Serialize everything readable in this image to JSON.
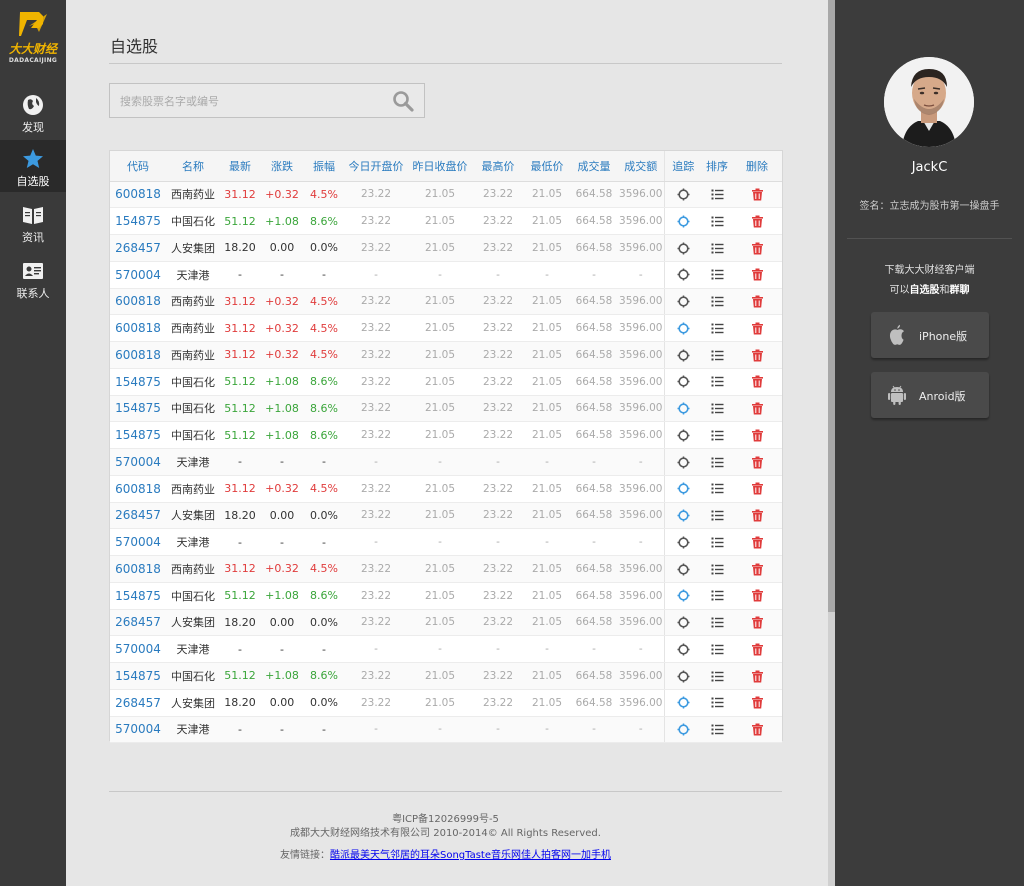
{
  "brand": {
    "name": "大大财经",
    "name_en": "DADACAIJING"
  },
  "nav": [
    {
      "label": "发现",
      "icon": "globe-icon"
    },
    {
      "label": "自选股",
      "icon": "star-icon",
      "active": true
    },
    {
      "label": "资讯",
      "icon": "book-icon"
    },
    {
      "label": "联系人",
      "icon": "contact-card-icon"
    }
  ],
  "page": {
    "title": "自选股"
  },
  "search": {
    "placeholder": "搜索股票名字或编号"
  },
  "table": {
    "headers": [
      "代码",
      "名称",
      "最新",
      "涨跌",
      "振幅",
      "今日开盘价",
      "昨日收盘价",
      "最高价",
      "最低价",
      "成交量",
      "成交额",
      "追踪",
      "排序",
      "删除"
    ],
    "rows": [
      {
        "code": "600818",
        "name": "西南药业",
        "latest": "31.12",
        "change": "+0.32",
        "amp": "4.5%",
        "open": "23.22",
        "prev": "21.05",
        "high": "23.22",
        "low": "21.05",
        "vol": "664.58",
        "amt": "3596.00",
        "trend": "red",
        "tracked": false
      },
      {
        "code": "154875",
        "name": "中国石化",
        "latest": "51.12",
        "change": "+1.08",
        "amp": "8.6%",
        "open": "23.22",
        "prev": "21.05",
        "high": "23.22",
        "low": "21.05",
        "vol": "664.58",
        "amt": "3596.00",
        "trend": "green",
        "tracked": true
      },
      {
        "code": "268457",
        "name": "人安集团",
        "latest": "18.20",
        "change": "0.00",
        "amp": "0.0%",
        "open": "23.22",
        "prev": "21.05",
        "high": "23.22",
        "low": "21.05",
        "vol": "664.58",
        "amt": "3596.00",
        "trend": "flat",
        "tracked": false
      },
      {
        "code": "570004",
        "name": "天津港",
        "latest": "-",
        "change": "-",
        "amp": "-",
        "open": "-",
        "prev": "-",
        "high": "-",
        "low": "-",
        "vol": "-",
        "amt": "-",
        "trend": "flat",
        "tracked": false
      },
      {
        "code": "600818",
        "name": "西南药业",
        "latest": "31.12",
        "change": "+0.32",
        "amp": "4.5%",
        "open": "23.22",
        "prev": "21.05",
        "high": "23.22",
        "low": "21.05",
        "vol": "664.58",
        "amt": "3596.00",
        "trend": "red",
        "tracked": false
      },
      {
        "code": "600818",
        "name": "西南药业",
        "latest": "31.12",
        "change": "+0.32",
        "amp": "4.5%",
        "open": "23.22",
        "prev": "21.05",
        "high": "23.22",
        "low": "21.05",
        "vol": "664.58",
        "amt": "3596.00",
        "trend": "red",
        "tracked": true
      },
      {
        "code": "600818",
        "name": "西南药业",
        "latest": "31.12",
        "change": "+0.32",
        "amp": "4.5%",
        "open": "23.22",
        "prev": "21.05",
        "high": "23.22",
        "low": "21.05",
        "vol": "664.58",
        "amt": "3596.00",
        "trend": "red",
        "tracked": false
      },
      {
        "code": "154875",
        "name": "中国石化",
        "latest": "51.12",
        "change": "+1.08",
        "amp": "8.6%",
        "open": "23.22",
        "prev": "21.05",
        "high": "23.22",
        "low": "21.05",
        "vol": "664.58",
        "amt": "3596.00",
        "trend": "green",
        "tracked": false
      },
      {
        "code": "154875",
        "name": "中国石化",
        "latest": "51.12",
        "change": "+1.08",
        "amp": "8.6%",
        "open": "23.22",
        "prev": "21.05",
        "high": "23.22",
        "low": "21.05",
        "vol": "664.58",
        "amt": "3596.00",
        "trend": "green",
        "tracked": true
      },
      {
        "code": "154875",
        "name": "中国石化",
        "latest": "51.12",
        "change": "+1.08",
        "amp": "8.6%",
        "open": "23.22",
        "prev": "21.05",
        "high": "23.22",
        "low": "21.05",
        "vol": "664.58",
        "amt": "3596.00",
        "trend": "green",
        "tracked": false
      },
      {
        "code": "570004",
        "name": "天津港",
        "latest": "-",
        "change": "-",
        "amp": "-",
        "open": "-",
        "prev": "-",
        "high": "-",
        "low": "-",
        "vol": "-",
        "amt": "-",
        "trend": "flat",
        "tracked": false
      },
      {
        "code": "600818",
        "name": "西南药业",
        "latest": "31.12",
        "change": "+0.32",
        "amp": "4.5%",
        "open": "23.22",
        "prev": "21.05",
        "high": "23.22",
        "low": "21.05",
        "vol": "664.58",
        "amt": "3596.00",
        "trend": "red",
        "tracked": true
      },
      {
        "code": "268457",
        "name": "人安集团",
        "latest": "18.20",
        "change": "0.00",
        "amp": "0.0%",
        "open": "23.22",
        "prev": "21.05",
        "high": "23.22",
        "low": "21.05",
        "vol": "664.58",
        "amt": "3596.00",
        "trend": "flat",
        "tracked": true
      },
      {
        "code": "570004",
        "name": "天津港",
        "latest": "-",
        "change": "-",
        "amp": "-",
        "open": "-",
        "prev": "-",
        "high": "-",
        "low": "-",
        "vol": "-",
        "amt": "-",
        "trend": "flat",
        "tracked": false
      },
      {
        "code": "600818",
        "name": "西南药业",
        "latest": "31.12",
        "change": "+0.32",
        "amp": "4.5%",
        "open": "23.22",
        "prev": "21.05",
        "high": "23.22",
        "low": "21.05",
        "vol": "664.58",
        "amt": "3596.00",
        "trend": "red",
        "tracked": false
      },
      {
        "code": "154875",
        "name": "中国石化",
        "latest": "51.12",
        "change": "+1.08",
        "amp": "8.6%",
        "open": "23.22",
        "prev": "21.05",
        "high": "23.22",
        "low": "21.05",
        "vol": "664.58",
        "amt": "3596.00",
        "trend": "green",
        "tracked": true
      },
      {
        "code": "268457",
        "name": "人安集团",
        "latest": "18.20",
        "change": "0.00",
        "amp": "0.0%",
        "open": "23.22",
        "prev": "21.05",
        "high": "23.22",
        "low": "21.05",
        "vol": "664.58",
        "amt": "3596.00",
        "trend": "flat",
        "tracked": false
      },
      {
        "code": "570004",
        "name": "天津港",
        "latest": "-",
        "change": "-",
        "amp": "-",
        "open": "-",
        "prev": "-",
        "high": "-",
        "low": "-",
        "vol": "-",
        "amt": "-",
        "trend": "flat",
        "tracked": false
      },
      {
        "code": "154875",
        "name": "中国石化",
        "latest": "51.12",
        "change": "+1.08",
        "amp": "8.6%",
        "open": "23.22",
        "prev": "21.05",
        "high": "23.22",
        "low": "21.05",
        "vol": "664.58",
        "amt": "3596.00",
        "trend": "green",
        "tracked": false
      },
      {
        "code": "268457",
        "name": "人安集团",
        "latest": "18.20",
        "change": "0.00",
        "amp": "0.0%",
        "open": "23.22",
        "prev": "21.05",
        "high": "23.22",
        "low": "21.05",
        "vol": "664.58",
        "amt": "3596.00",
        "trend": "flat",
        "tracked": true
      },
      {
        "code": "570004",
        "name": "天津港",
        "latest": "-",
        "change": "-",
        "amp": "-",
        "open": "-",
        "prev": "-",
        "high": "-",
        "low": "-",
        "vol": "-",
        "amt": "-",
        "trend": "flat",
        "tracked": true
      }
    ]
  },
  "footer": {
    "icp": "粤ICP备12026999号-5",
    "copyright": "成都大大财经网络技术有限公司 2010-2014© All Rights Reserved.",
    "links_label": "友情链接：",
    "links": [
      "酷派最美天气",
      "邻居的耳朵",
      "SongTaste音乐网",
      "佳人",
      "拍客网",
      "一加手机"
    ]
  },
  "profile": {
    "username": "JackC",
    "signature": "签名：立志成为股市第一操盘手",
    "download_line1": "下载大大财经客户端",
    "download_line2_prefix": "可以",
    "download_line2_bold1": "自选股",
    "download_line2_mid": "和",
    "download_line2_bold2": "群聊",
    "iphone_label": "iPhone版",
    "android_label": "Anroid版"
  },
  "colors": {
    "accent": "#2a7bbf",
    "up": "#e03b3b",
    "down": "#3aa53a",
    "logo": "#f0b400"
  }
}
